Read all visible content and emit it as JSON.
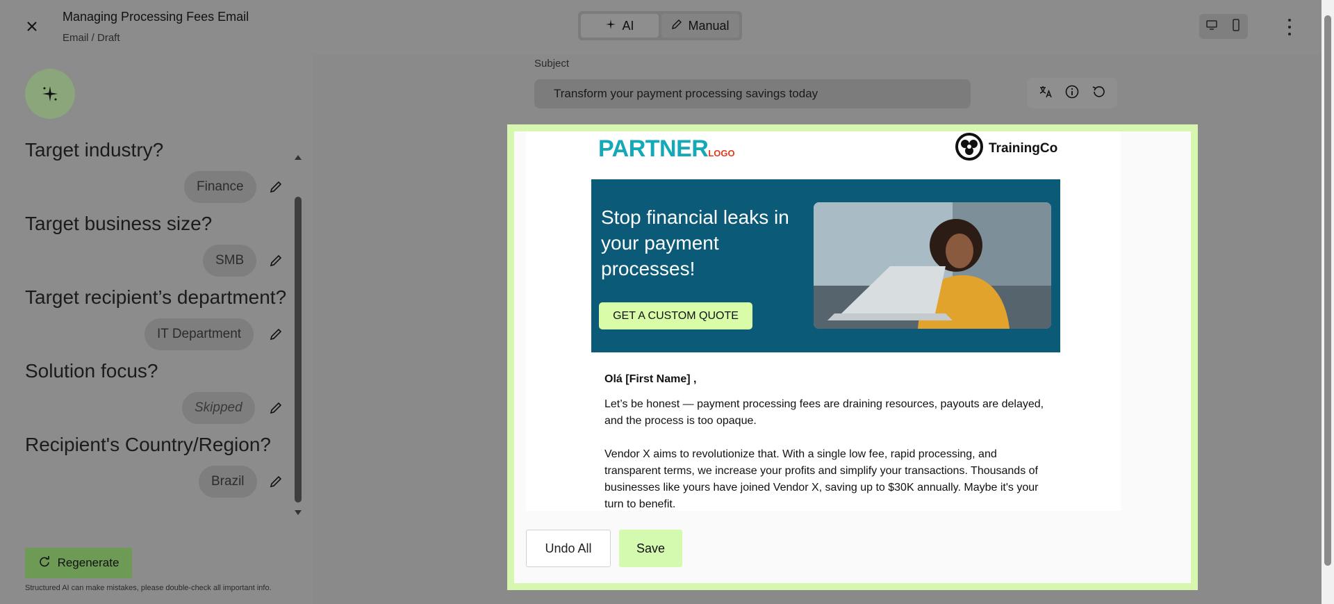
{
  "header": {
    "title": "Managing Processing Fees Email",
    "breadcrumb": "Email / Draft",
    "modes": [
      {
        "label": "AI",
        "icon": "sparkle-icon"
      },
      {
        "label": "Manual",
        "icon": "pencil-icon"
      }
    ],
    "device_icons": [
      "desktop-icon",
      "mobile-icon"
    ]
  },
  "sidebar": {
    "questions": [
      {
        "label": "Target industry?",
        "answer": "Finance",
        "skipped": false
      },
      {
        "label": "Target business size?",
        "answer": "SMB",
        "skipped": false
      },
      {
        "label": "Target recipient’s department?",
        "answer": "IT Department",
        "skipped": false
      },
      {
        "label": "Solution focus?",
        "answer": "Skipped",
        "skipped": true
      },
      {
        "label": "Recipient's Country/Region?",
        "answer": "Brazil",
        "skipped": false
      }
    ],
    "regenerate_label": "Regenerate",
    "disclaimer": "Structured AI can make mistakes, please double-check all important info."
  },
  "main": {
    "subject_label": "Subject",
    "subject_value": "Transform your payment processing savings today",
    "tool_icons": [
      "translate-icon",
      "info-icon",
      "history-icon"
    ]
  },
  "email": {
    "partner_logo": "PARTNER",
    "partner_logo_small": "LOGO",
    "brand_name": "TrainingCo",
    "hero_title": "Stop financial leaks in your payment processes!",
    "hero_cta": "GET A CUSTOM QUOTE",
    "greeting": "Olá  [First Name] ,",
    "paragraph1": "Let’s be honest — payment processing fees are draining resources, payouts are delayed, and the process is too opaque.",
    "paragraph2": "Vendor X aims to revolutionize that. With a single low fee, rapid processing, and transparent terms, we increase your profits and simplify your transactions. Thousands of businesses like yours have joined Vendor X, saving up to $30K annually. Maybe it's your turn to benefit."
  },
  "modal": {
    "undo_label": "Undo All",
    "save_label": "Save"
  },
  "colors": {
    "accent_green": "#d7f7b0",
    "hero_blue": "#0b5a78",
    "partner_teal": "#13a9b7",
    "partner_red": "#e23a1d"
  }
}
